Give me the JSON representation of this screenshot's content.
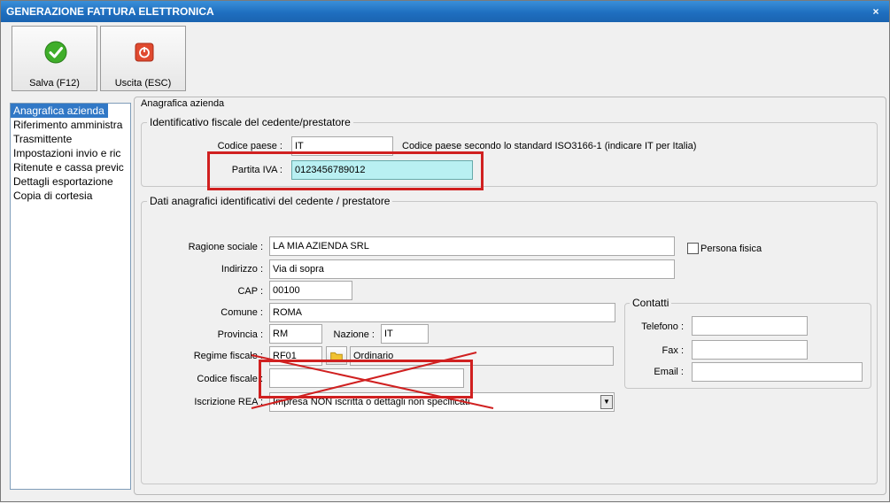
{
  "window": {
    "title": "GENERAZIONE FATTURA ELETTRONICA",
    "close_glyph": "×"
  },
  "toolbar": {
    "save_label": "Salva (F12)",
    "exit_label": "Uscita (ESC)"
  },
  "nav": {
    "items": [
      "Anagrafica azienda",
      "Riferimento amministra",
      "Trasmittente",
      "Impostazioni invio e ric",
      "Ritenute e cassa previc",
      "Dettagli esportazione",
      "Copia di cortesia"
    ],
    "selected": "Anagrafica azienda"
  },
  "panel": {
    "title": "Anagrafica azienda"
  },
  "fiscal_id": {
    "title": "Identificativo fiscale del cedente/prestatore",
    "country_label": "Codice paese :",
    "country_value": "IT",
    "country_hint": "Codice paese secondo lo standard ISO3166-1 (indicare IT per Italia)",
    "vat_label": "Partita IVA :",
    "vat_value": "0123456789012"
  },
  "registry": {
    "title": "Dati anagrafici identificativi del cedente / prestatore",
    "company_label": "Ragione sociale :",
    "company_value": "LA MIA AZIENDA SRL",
    "person_label": "Persona fisica",
    "address_label": "Indirizzo :",
    "address_value": "Via di sopra",
    "cap_label": "CAP :",
    "cap_value": "00100",
    "city_label": "Comune :",
    "city_value": "ROMA",
    "province_label": "Provincia :",
    "province_value": "RM",
    "nation_label": "Nazione :",
    "nation_value": "IT",
    "regime_label": "Regime fiscale :",
    "regime_code": "RF01",
    "regime_desc": "Ordinario",
    "cf_label": "Codice fiscale :",
    "cf_value": "",
    "rea_label": "Iscrizione REA :",
    "rea_value": "Impresa NON iscritta o dettagli non specificati"
  },
  "contacts": {
    "title": "Contatti",
    "phone_label": "Telefono :",
    "phone_value": "",
    "fax_label": "Fax :",
    "fax_value": "",
    "email_label": "Email :",
    "email_value": ""
  },
  "colors": {
    "highlight": "#d02020",
    "selection": "#3178c6",
    "vat_field": "#b9f0f2"
  }
}
